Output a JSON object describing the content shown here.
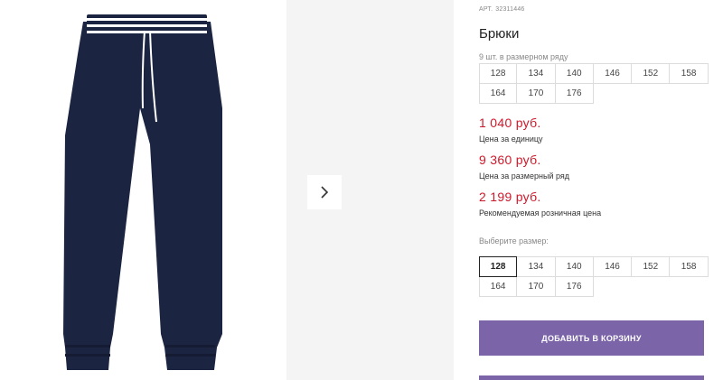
{
  "product": {
    "art_label": "АРТ.",
    "art_number": "32311446",
    "title": "Брюки",
    "row_note": "9 шт. в размерном ряду"
  },
  "size_row": {
    "sizes": [
      "128",
      "134",
      "140",
      "146",
      "152",
      "158",
      "164",
      "170",
      "176"
    ]
  },
  "prices": {
    "unit_price": "1 040 руб.",
    "unit_label": "Цена за единицу",
    "row_price": "9 360 руб.",
    "row_label": "Цена за размерный ряд",
    "retail_price": "2 199 руб.",
    "retail_label": "Рекомендуемая розничная цена"
  },
  "size_picker": {
    "label": "Выберите размер:",
    "sizes": [
      "128",
      "134",
      "140",
      "146",
      "152",
      "158",
      "164",
      "170",
      "176"
    ],
    "selected": "128"
  },
  "actions": {
    "add_to_cart": "ДОБАВИТЬ В КОРЗИНУ"
  },
  "colors": {
    "price": "#d0182a",
    "button": "#7b65a8",
    "pants": "#1b2440"
  },
  "icons": {
    "next": "chevron-right-icon"
  }
}
